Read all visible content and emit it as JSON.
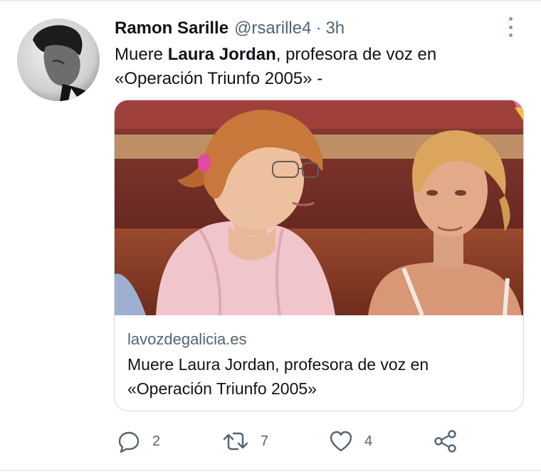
{
  "tweet": {
    "author_name": "Ramon Sarille",
    "handle": "@rsarille4",
    "separator": "·",
    "time": "3h",
    "text_prefix": "Muere ",
    "text_bold": "Laura Jordan",
    "text_suffix": ", profesora de voz en «Operación Triunfo 2005» -"
  },
  "card": {
    "domain": "lavozdegalicia.es",
    "title": "Muere Laura Jordan, profesora de voz en «Operación Triunfo 2005»"
  },
  "actions": {
    "reply_count": "2",
    "retweet_count": "7",
    "like_count": "4"
  },
  "icons": {
    "more": "more-vertical-icon",
    "reply": "reply-icon",
    "retweet": "retweet-icon",
    "like": "heart-icon",
    "share": "share-icon"
  },
  "colors": {
    "text": "#0f1419",
    "secondary": "#536471",
    "border": "#cfd9de"
  }
}
